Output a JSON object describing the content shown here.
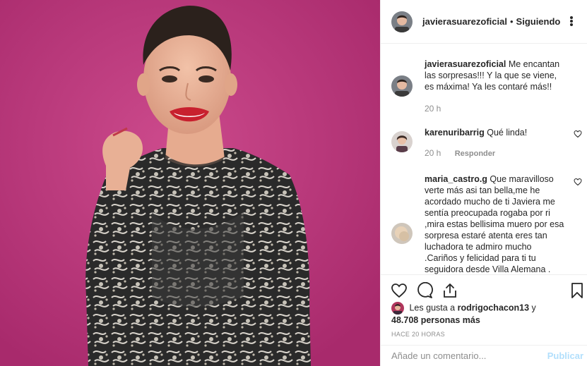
{
  "post_owner": {
    "username": "javierasuarezoficial",
    "separator": "•",
    "follow_status": "Siguiendo"
  },
  "photo": {
    "background_color": "#c03a80"
  },
  "comments": [
    {
      "username": "javierasuarezoficial",
      "text": "Me encantan las sorpresas!!! Y la que se viene, es máxima! Ya les contaré más!!",
      "time": "20 h"
    },
    {
      "username": "karenuribarrig",
      "text": "Qué linda!",
      "time": "20 h",
      "reply_label": "Responder"
    },
    {
      "username": "maria_castro.g",
      "text": "Que maravilloso verte más asi tan bella,me he acordado mucho de ti Javiera me sentía preocupada rogaba por ri ,mira estas bellisima muero por esa sorpresa estaré atenta eres tan luchadora te admiro mucho .Cariños y felicidad para ti tu seguidora desde Villa Alemana ."
    }
  ],
  "likes": {
    "prefix": "Les gusta a",
    "first_user": "rodrigochacon13",
    "conjunction": "y",
    "others": "48.708 personas más"
  },
  "timestamp": "HACE 20 HORAS",
  "comment_box": {
    "placeholder": "Añade un comentario...",
    "submit_label": "Publicar"
  }
}
